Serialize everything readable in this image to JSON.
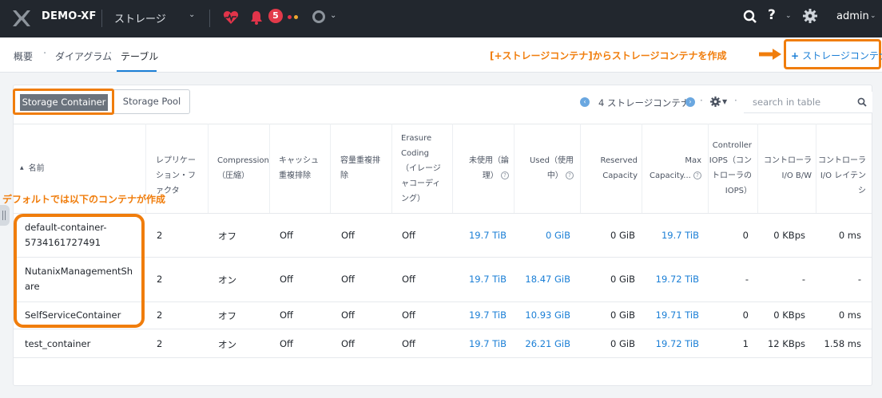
{
  "topbar": {
    "cluster_name": "DEMO-XF",
    "section": "ストレージ",
    "alert_count": "5",
    "user": "admin",
    "help_label": "?",
    "colors": {
      "bar": "#22272e",
      "alert": "#e23a4a",
      "dot1": "#e2344a",
      "dot2": "#f0a830"
    }
  },
  "subnav": {
    "crumbs": [
      "概要",
      "ダイアグラム",
      "テーブル"
    ],
    "add_button_label": "ストレージコンテナ",
    "callout": "[+ストレージコンテナ]からストレージコンテナを作成"
  },
  "toggle": {
    "options": [
      "Storage Container",
      "Storage Pool"
    ],
    "selected": "Storage Container"
  },
  "pager": {
    "count_label": "4 ストレージコンテナ"
  },
  "search": {
    "placeholder": "search in table"
  },
  "table": {
    "headers": {
      "name": "名前",
      "replication": "レプリケーション・ファクタ",
      "compression": "Compression（圧縮）",
      "cache_dedup": "キャッシュ重複排除",
      "capacity_dedup": "容量重複排除",
      "erasure": "Erasure Coding （イレージャコーディング）",
      "free": "未使用（論理）",
      "used": "Used（使用中）",
      "reserved": "Reserved Capacity",
      "max_capacity": "Max Capacity...",
      "controller_iops": "Controller IOPS（コントローラのIOPS）",
      "controller_bw": "コントローラI/O B/W",
      "controller_latency": "コントローラI/O レイテンシ"
    },
    "rows": [
      {
        "name": "default-container-5734161727491",
        "replication": "2",
        "compression": "オフ",
        "cache_dedup": "Off",
        "capacity_dedup": "Off",
        "erasure": "Off",
        "free": "19.7 TiB",
        "used": "0 GiB",
        "reserved": "0 GiB",
        "max_capacity": "19.7 TiB",
        "iops": "0",
        "bw": "0 KBps",
        "latency": "0 ms"
      },
      {
        "name": "NutanixManagementShare",
        "replication": "2",
        "compression": "オン",
        "cache_dedup": "Off",
        "capacity_dedup": "Off",
        "erasure": "Off",
        "free": "19.7 TiB",
        "used": "18.47 GiB",
        "reserved": "0 GiB",
        "max_capacity": "19.72 TiB",
        "iops": "-",
        "bw": "-",
        "latency": "-"
      },
      {
        "name": "SelfServiceContainer",
        "replication": "2",
        "compression": "オフ",
        "cache_dedup": "Off",
        "capacity_dedup": "Off",
        "erasure": "Off",
        "free": "19.7 TiB",
        "used": "10.93 GiB",
        "reserved": "0 GiB",
        "max_capacity": "19.71 TiB",
        "iops": "0",
        "bw": "0 KBps",
        "latency": "0 ms"
      },
      {
        "name": "test_container",
        "replication": "2",
        "compression": "オン",
        "cache_dedup": "Off",
        "capacity_dedup": "Off",
        "erasure": "Off",
        "free": "19.7 TiB",
        "used": "26.21 GiB",
        "reserved": "0 GiB",
        "max_capacity": "19.72 TiB",
        "iops": "1",
        "bw": "12 KBps",
        "latency": "1.58 ms"
      }
    ],
    "annotation": "デフォルトでは以下のコンテナが作成"
  },
  "theme": {
    "accent": "#1b7fd6",
    "callout": "#f07d0c"
  }
}
